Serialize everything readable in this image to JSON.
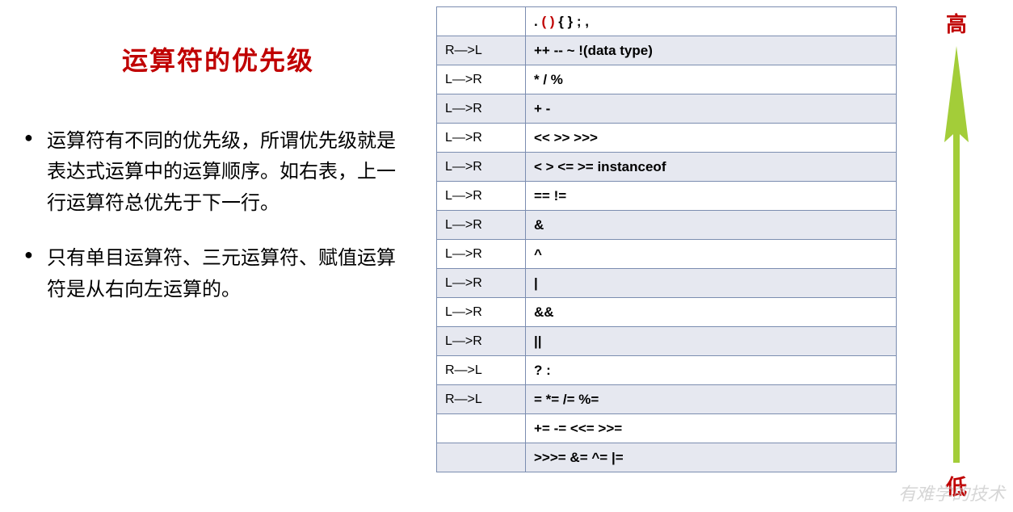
{
  "title": "运算符的优先级",
  "bullets": [
    "运算符有不同的优先级，所谓优先级就是表达式运算中的运算顺序。如右表，上一行运算符总优先于下一行。",
    "只有单目运算符、三元运算符、赋值运算符是从右向左运算的。"
  ],
  "labels": {
    "high": "高",
    "low": "低"
  },
  "watermark": "有难学的技术",
  "rows": [
    {
      "assoc": "",
      "ops_pre": ".   ",
      "ops_red": "( )",
      "ops_post": "    { }    ;    ,"
    },
    {
      "assoc": "R—>L",
      "ops": "++    --    ~    !(data type)"
    },
    {
      "assoc": "L—>R",
      "ops": "*    /    %"
    },
    {
      "assoc": "L—>R",
      "ops": "+    -"
    },
    {
      "assoc": "L—>R",
      "ops": "<<    >>    >>>"
    },
    {
      "assoc": "L—>R",
      "ops": "<    >    <=    >=    instanceof"
    },
    {
      "assoc": "L—>R",
      "ops": "==    !="
    },
    {
      "assoc": "L—>R",
      "ops": "&"
    },
    {
      "assoc": "L—>R",
      "ops": "^"
    },
    {
      "assoc": "L—>R",
      "ops": "|"
    },
    {
      "assoc": "L—>R",
      "ops": "&&"
    },
    {
      "assoc": "L—>R",
      "ops": "||"
    },
    {
      "assoc": "R—>L",
      "ops": "?    :"
    },
    {
      "assoc": "R—>L",
      "ops": "=    *=    /=    %="
    },
    {
      "assoc": "",
      "ops": "+=    -=    <<=    >>="
    },
    {
      "assoc": "",
      "ops": ">>>=    &=    ^=    |="
    }
  ]
}
